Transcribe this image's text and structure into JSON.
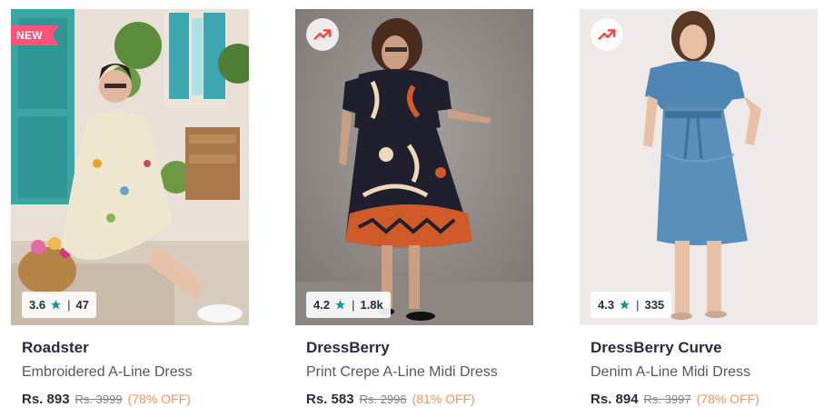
{
  "colors": {
    "accent_new_badge": "#ff527b",
    "rating_star": "#14958f",
    "discount_text": "#ff905a",
    "trend_icon": "#ff3f3f"
  },
  "products": [
    {
      "badge": "NEW",
      "rating": "3.6",
      "rating_count": "47",
      "brand": "Roadster",
      "name": "Embroidered A-Line Dress",
      "price": "Rs. 893",
      "mrp": "Rs. 3999",
      "discount": "(78% OFF)",
      "image_icon": "product-photo-roadster-dress"
    },
    {
      "badge_icon": "trending-icon",
      "rating": "4.2",
      "rating_count": "1.8k",
      "brand": "DressBerry",
      "name": "Print Crepe A-Line Midi Dress",
      "price": "Rs. 583",
      "mrp": "Rs. 2996",
      "discount": "(81% OFF)",
      "image_icon": "product-photo-dressberry-dress"
    },
    {
      "badge_icon": "trending-icon",
      "rating": "4.3",
      "rating_count": "335",
      "brand": "DressBerry Curve",
      "name": "Denim A-Line Midi Dress",
      "price": "Rs. 894",
      "mrp": "Rs. 3997",
      "discount": "(78% OFF)",
      "image_icon": "product-photo-dressberry-curve-dress"
    }
  ]
}
